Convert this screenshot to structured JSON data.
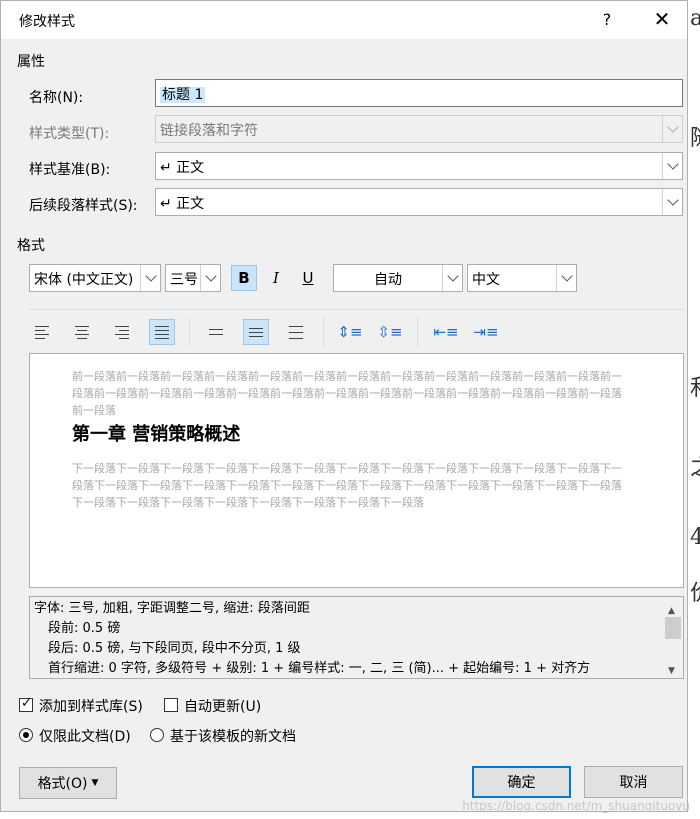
{
  "dialog": {
    "title": "修改样式",
    "help": "?",
    "close": "✕"
  },
  "properties": {
    "section": "属性",
    "name_label": "名称(N):",
    "name_value": "标题 1",
    "type_label": "样式类型(T):",
    "type_value": "链接段落和字符",
    "based_label": "样式基准(B):",
    "based_value": "↵ 正文",
    "next_label": "后续段落样式(S):",
    "next_value": "↵ 正文"
  },
  "format": {
    "section": "格式",
    "font": "宋体 (中文正文)",
    "size": "三号",
    "bold": "B",
    "italic": "I",
    "underline": "U",
    "color": "自动",
    "lang": "中文"
  },
  "preview": {
    "prev_para": "前一段落前一段落前一段落前一段落前一段落前一段落前一段落前一段落前一段落前一段落前一段落前一段落前一段落前一段落前一段落前一段落前一段落前一段落前一段落前一段落前一段落前一段落前一段落前一段落前一段落前一段落",
    "heading": "第一章   营销策略概述",
    "next_para": "下一段落下一段落下一段落下一段落下一段落下一段落下一段落下一段落下一段落下一段落下一段落下一段落下一段落下一段落下一段落下一段落下一段落下一段落下一段落下一段落下一段落下一段落下一段落下一段落下一段落下一段落下一段落下一段落下一段落下一段落下一段落下一段落下一段落"
  },
  "description": {
    "line1": "字体: 三号, 加粗, 字距调整二号, 缩进: 段落间距",
    "line2": "段前: 0.5 磅",
    "line3": "段后: 0.5 磅, 与下段同页, 段中不分页, 1 级",
    "line4": "首行缩进:  0 字符, 多级符号 + 级别: 1 + 编号样式: 一, 二, 三 (简)... + 起始编号: 1 + 对齐方"
  },
  "options": {
    "add_gallery": "添加到样式库(S)",
    "auto_update": "自动更新(U)",
    "this_doc": "仅限此文档(D)",
    "new_docs": "基于该模板的新文档"
  },
  "buttons": {
    "format": "格式(O)",
    "ok": "确定",
    "cancel": "取消"
  },
  "background": {
    "c1": "a",
    "c2": "随",
    "c3": "和",
    "c4": "之",
    "c5": "4",
    "c6": "价"
  },
  "watermark": "https://blog.csdn.net/m_shuangituoyu"
}
